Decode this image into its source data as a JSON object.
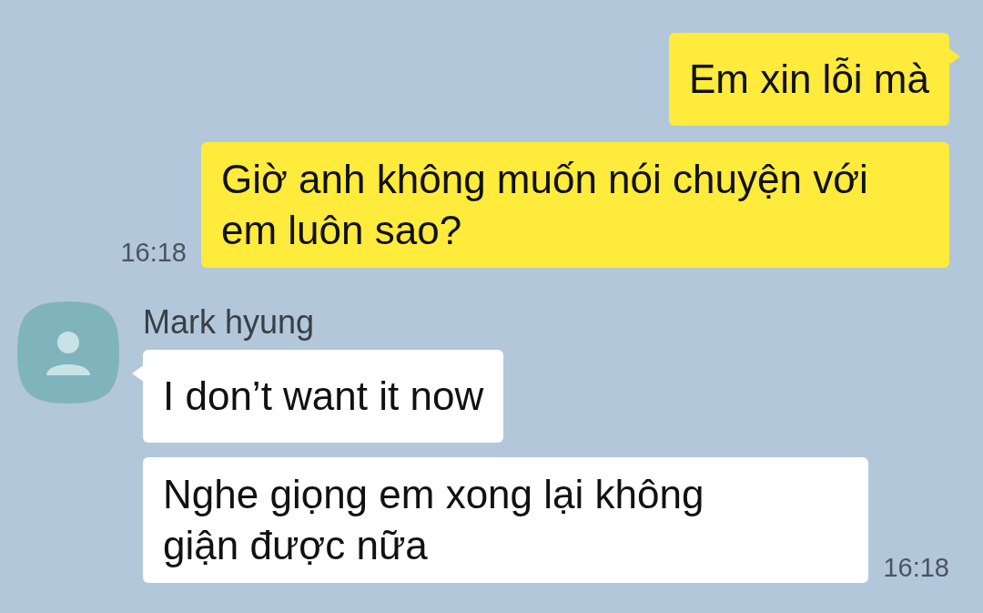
{
  "messages": [
    {
      "kind": "sent",
      "text": "Em xin lỗi mà",
      "first": true
    },
    {
      "kind": "sent",
      "text": "Giờ anh không muốn nói chuyện với em luôn sao?",
      "first": false,
      "time": "16:18"
    },
    {
      "kind": "received",
      "sender": "Mark hyung",
      "text": "I don’t want it now",
      "first": true
    },
    {
      "kind": "received",
      "text": "Nghe giọng em xong lại không giận được nữa",
      "first": false,
      "time": "16:18"
    }
  ]
}
